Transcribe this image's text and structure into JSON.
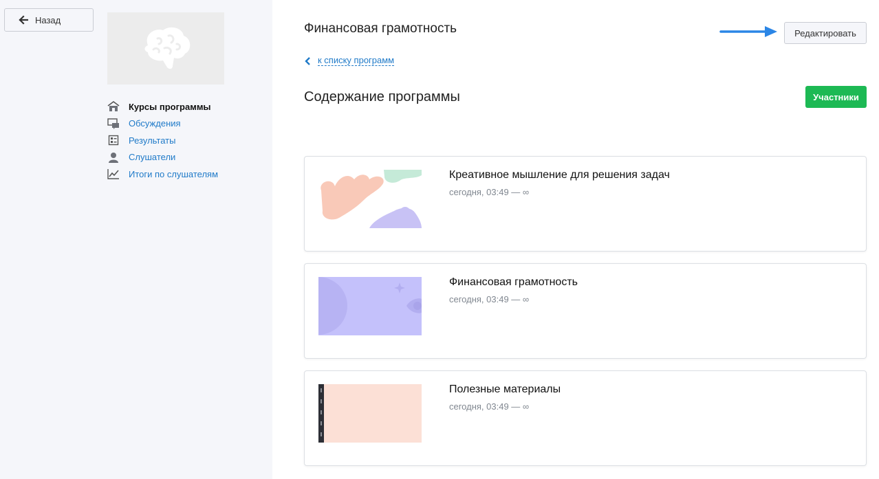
{
  "sidebar": {
    "back_label": "Назад",
    "nav": [
      {
        "label": "Курсы программы",
        "icon": "home-icon",
        "active": true
      },
      {
        "label": "Обсуждения",
        "icon": "chat-icon",
        "active": false
      },
      {
        "label": "Результаты",
        "icon": "results-icon",
        "active": false
      },
      {
        "label": "Слушатели",
        "icon": "user-icon",
        "active": false
      },
      {
        "label": "Итоги по слушателям",
        "icon": "chart-icon",
        "active": false
      }
    ]
  },
  "header": {
    "title": "Финансовая грамотность",
    "edit_label": "Редактировать",
    "back_to_list": "к списку программ"
  },
  "content": {
    "section_title": "Содержание программы",
    "members_label": "Участники",
    "courses": [
      {
        "title": "Креативное мышление для решения задач",
        "date": "сегодня, 03:49 — ∞"
      },
      {
        "title": "Финансовая грамотность",
        "date": "сегодня, 03:49 — ∞"
      },
      {
        "title": "Полезные материалы",
        "date": "сегодня, 03:49 — ∞"
      }
    ]
  },
  "colors": {
    "accent": "#1f7ac8",
    "success": "#1db954",
    "annotation_arrow": "#2b86e6"
  }
}
